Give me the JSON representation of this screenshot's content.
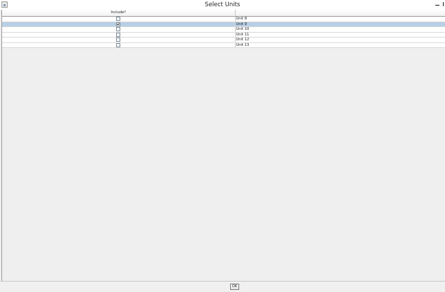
{
  "window": {
    "title": "Select Units",
    "icon": "java-app-icon",
    "controls": [
      "minimize-icon",
      "close-icon"
    ]
  },
  "table": {
    "columns": [
      "Include?",
      ""
    ],
    "rows": [
      {
        "included": false,
        "name": "Unit 8"
      },
      {
        "included": true,
        "name": "Unit 9",
        "selected": true
      },
      {
        "included": false,
        "name": "Unit 10"
      },
      {
        "included": false,
        "name": "Unit 11"
      },
      {
        "included": false,
        "name": "Unit 12"
      },
      {
        "included": false,
        "name": "Unit 13"
      }
    ]
  },
  "footer": {
    "ok_label": "OK"
  },
  "colors": {
    "selected_row": "#b8cfe5",
    "background": "#efefef"
  }
}
